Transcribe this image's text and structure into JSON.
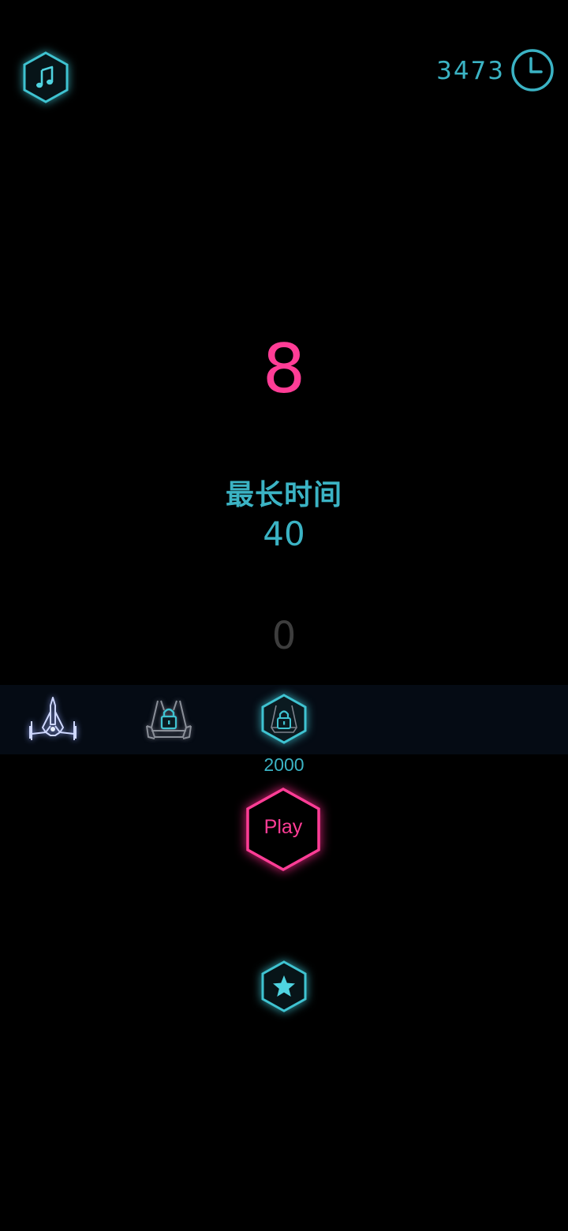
{
  "top_bar": {
    "music_icon": "music-note-icon",
    "total_time": "3473",
    "clock_icon": "clock-icon"
  },
  "score": "8",
  "best": {
    "label": "最长时间",
    "value": "40"
  },
  "coins": "0",
  "ships": [
    {
      "name": "fighter",
      "state": "selected"
    },
    {
      "name": "tank",
      "state": "locked"
    },
    {
      "name": "hex-ship",
      "state": "locked",
      "price": "2000"
    }
  ],
  "play_label": "Play",
  "star_icon": "star-icon",
  "colors": {
    "cyan": "#3bb3c4",
    "pink": "#ff3d96",
    "background": "#000000",
    "strip": "#050b14"
  }
}
